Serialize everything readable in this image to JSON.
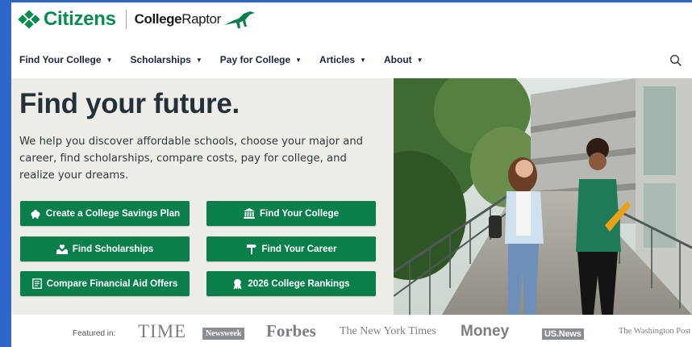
{
  "brand": {
    "citizens": "Citizens",
    "partner_strong": "College",
    "partner_light": "Raptor"
  },
  "nav": {
    "items": [
      {
        "label": "Find Your College"
      },
      {
        "label": "Scholarships"
      },
      {
        "label": "Pay for College"
      },
      {
        "label": "Articles"
      },
      {
        "label": "About"
      }
    ],
    "search_icon": "search-icon"
  },
  "hero": {
    "title": "Find your future.",
    "description": "We help you discover affordable schools, choose your major and career, find scholarships, compare costs, pay for college, and realize your dreams.",
    "buttons": [
      {
        "label": "Create a College Savings Plan",
        "icon": "piggy-bank-icon"
      },
      {
        "label": "Find Your College",
        "icon": "institution-icon"
      },
      {
        "label": "Find Scholarships",
        "icon": "hand-heart-icon"
      },
      {
        "label": "Find Your Career",
        "icon": "signpost-icon"
      },
      {
        "label": "Compare Financial Aid Offers",
        "icon": "document-icon"
      },
      {
        "label": "2026 College Rankings",
        "icon": "award-ribbon-icon"
      }
    ]
  },
  "featured": {
    "label": "Featured in:",
    "publications": [
      "TIME",
      "Newsweek",
      "Forbes",
      "The New York Times",
      "Money",
      "US.News",
      "The Washington Post"
    ]
  },
  "colors": {
    "brand_green": "#0a7f4c",
    "hero_bg": "#efede7",
    "window_bg": "#2f66c9"
  }
}
